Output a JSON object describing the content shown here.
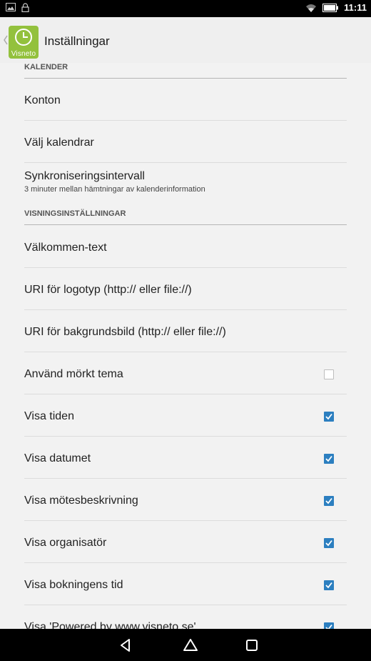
{
  "status_bar": {
    "time": "11:11",
    "icons_left": [
      "image-icon",
      "lock-icon"
    ],
    "icons_right": [
      "wifi-icon",
      "battery-icon"
    ]
  },
  "action_bar": {
    "logo_text": "Visneto",
    "title": "Inställningar"
  },
  "sections": [
    {
      "header": "KALENDER",
      "items": [
        {
          "title": "Konton"
        },
        {
          "title": "Välj kalendrar"
        },
        {
          "title": "Synkroniseringsintervall",
          "subtitle": "3 minuter mellan hämtningar av kalenderinformation"
        }
      ]
    },
    {
      "header": "VISNINGSINSTÄLLNINGAR",
      "items": [
        {
          "title": "Välkommen-text"
        },
        {
          "title": "URI för logotyp (http:// eller file://)"
        },
        {
          "title": "URI för bakgrundsbild (http:// eller file://)"
        },
        {
          "title": "Använd mörkt tema",
          "checked": false
        },
        {
          "title": "Visa tiden",
          "checked": true
        },
        {
          "title": "Visa datumet",
          "checked": true
        },
        {
          "title": "Visa mötesbeskrivning",
          "checked": true
        },
        {
          "title": "Visa organisatör",
          "checked": true
        },
        {
          "title": "Visa bokningens tid",
          "checked": true
        },
        {
          "title": "Visa 'Powered by www.visneto.se'",
          "checked": true
        }
      ]
    }
  ],
  "colors": {
    "accent": "#2c7fc0",
    "logo_green": "#93c13d",
    "background": "#f2f2f2"
  },
  "nav_bar": [
    "back-icon",
    "home-icon",
    "recents-icon"
  ]
}
